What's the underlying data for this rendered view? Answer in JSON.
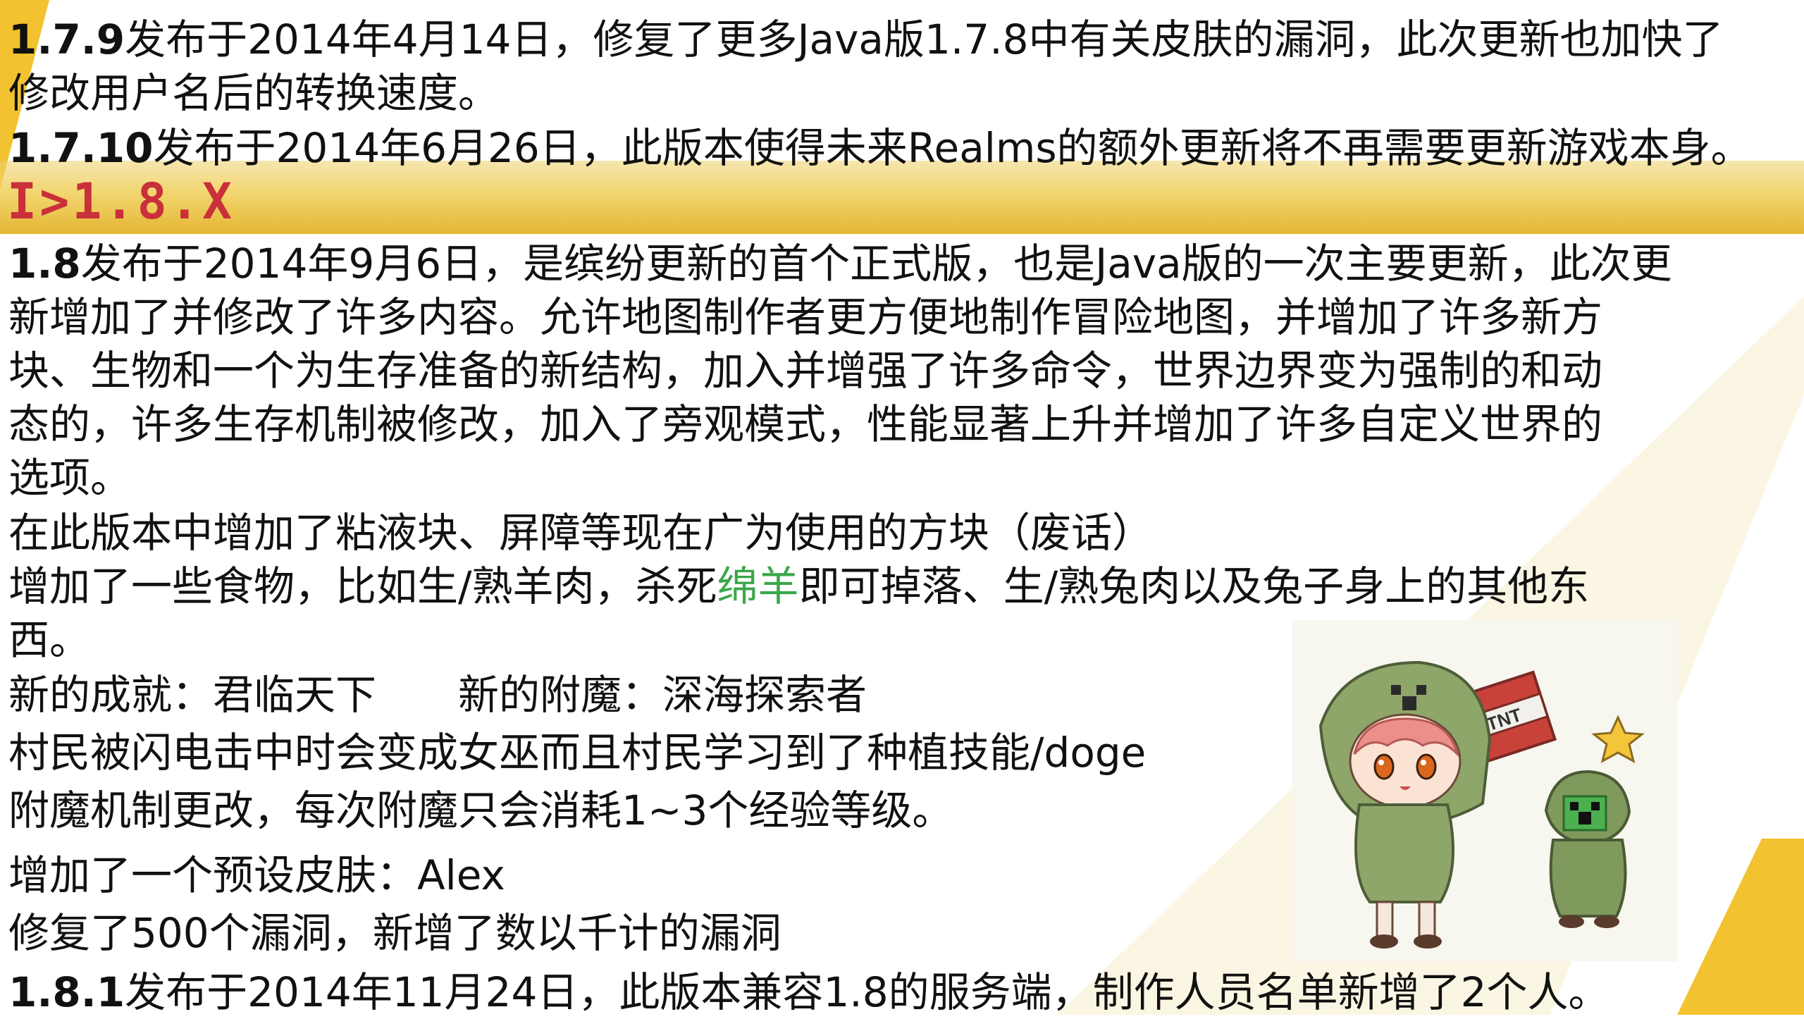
{
  "page": {
    "section_heading": "I>1.8.X",
    "v179": {
      "version": "1.7.9",
      "line1": "发布于2014年4月14日，修复了更多Java版1.7.8中有关皮肤的漏洞，此次更新也加快了",
      "line2": "修改用户名后的转换速度。"
    },
    "v1710": {
      "version": "1.7.10",
      "text": "发布于2014年6月26日，此版本使得未来Realms的额外更新将不再需要更新游戏本身。"
    },
    "v18": {
      "version": "1.8",
      "line1": "发布于2014年9月6日，是缤纷更新的首个正式版，也是Java版的一次主要更新，此次更",
      "line2": "新增加了并修改了许多内容。允许地图制作者更方便地制作冒险地图，并增加了许多新方",
      "line3": "块、生物和一个为生存准备的新结构，加入并增强了许多命令，世界边界变为强制的和动",
      "line4": "态的，许多生存机制被修改，加入了旁观模式，性能显著上升并增加了许多自定义世界的",
      "line5": "选项。"
    },
    "blocks_line": "在此版本中增加了粘液块、屏障等现在广为使用的方块（废话）",
    "food": {
      "before": "增加了一些食物，比如生/熟羊肉，杀死",
      "link": "绵羊",
      "after": "即可掉落、生/熟兔肉以及兔子身上的其他东",
      "line2": "西。"
    },
    "achievement_line": "新的成就：君临天下　　新的附魔：深海探索者",
    "villager_line": "村民被闪电击中时会变成女巫而且村民学习到了种植技能/doge",
    "enchant_line": "附魔机制更改，每次附魔只会消耗1~3个经验等级。",
    "skin_line": "增加了一个预设皮肤：Alex",
    "bugs_line": "修复了500个漏洞，新增了数以千计的漏洞",
    "v181": {
      "version": "1.8.1",
      "text": "发布于2014年11月24日，此版本兼容1.8的服务端，制作人员名单新增了2个人。"
    },
    "illustration": {
      "tnt_label": "TNT"
    }
  },
  "colors": {
    "accent_yellow": "#f2c230",
    "heading_red": "#c9303a",
    "link_green": "#3aa74a"
  }
}
